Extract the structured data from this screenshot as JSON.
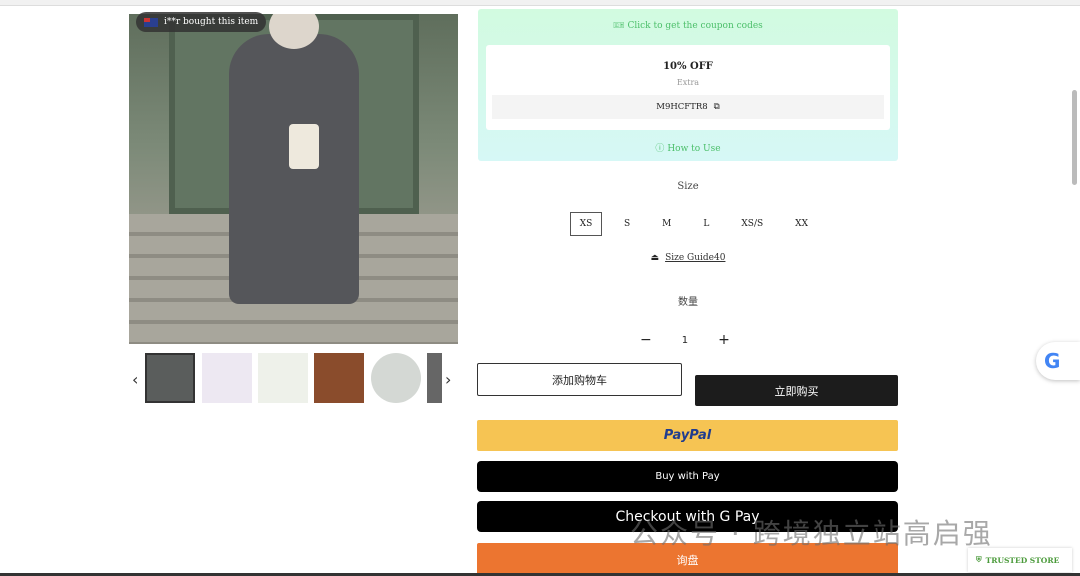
{
  "social_proof": {
    "text": "i**r bought this item"
  },
  "coupon": {
    "header": "Click to get the coupon codes",
    "title": "10% OFF",
    "subtitle": "Extra",
    "code": "M9HCFTR8",
    "how_to_use": "How to Use"
  },
  "size": {
    "label": "Size",
    "options": [
      "XS",
      "S",
      "M",
      "L",
      "XS/S",
      "XX"
    ],
    "selected": "XS",
    "guide": "Size Guide40"
  },
  "quantity": {
    "label": "数量",
    "value": "1",
    "minus": "−",
    "plus": "+"
  },
  "buttons": {
    "add_to_cart": "添加购物车",
    "buy_now": "立即购买",
    "paypal": "PayPal",
    "apple_pay": "Buy with  Pay",
    "google_pay": "Checkout with G Pay",
    "inquiry": "询盘"
  },
  "google_badge": "G",
  "watermark": "公众号 · 跨境独立站高启强",
  "trusted_store": "TRUSTED STORE",
  "colors": {
    "coupon_green": "#4cbf6a",
    "paypal": "#f6c453",
    "inquiry": "#ec7530",
    "black": "#000000"
  }
}
